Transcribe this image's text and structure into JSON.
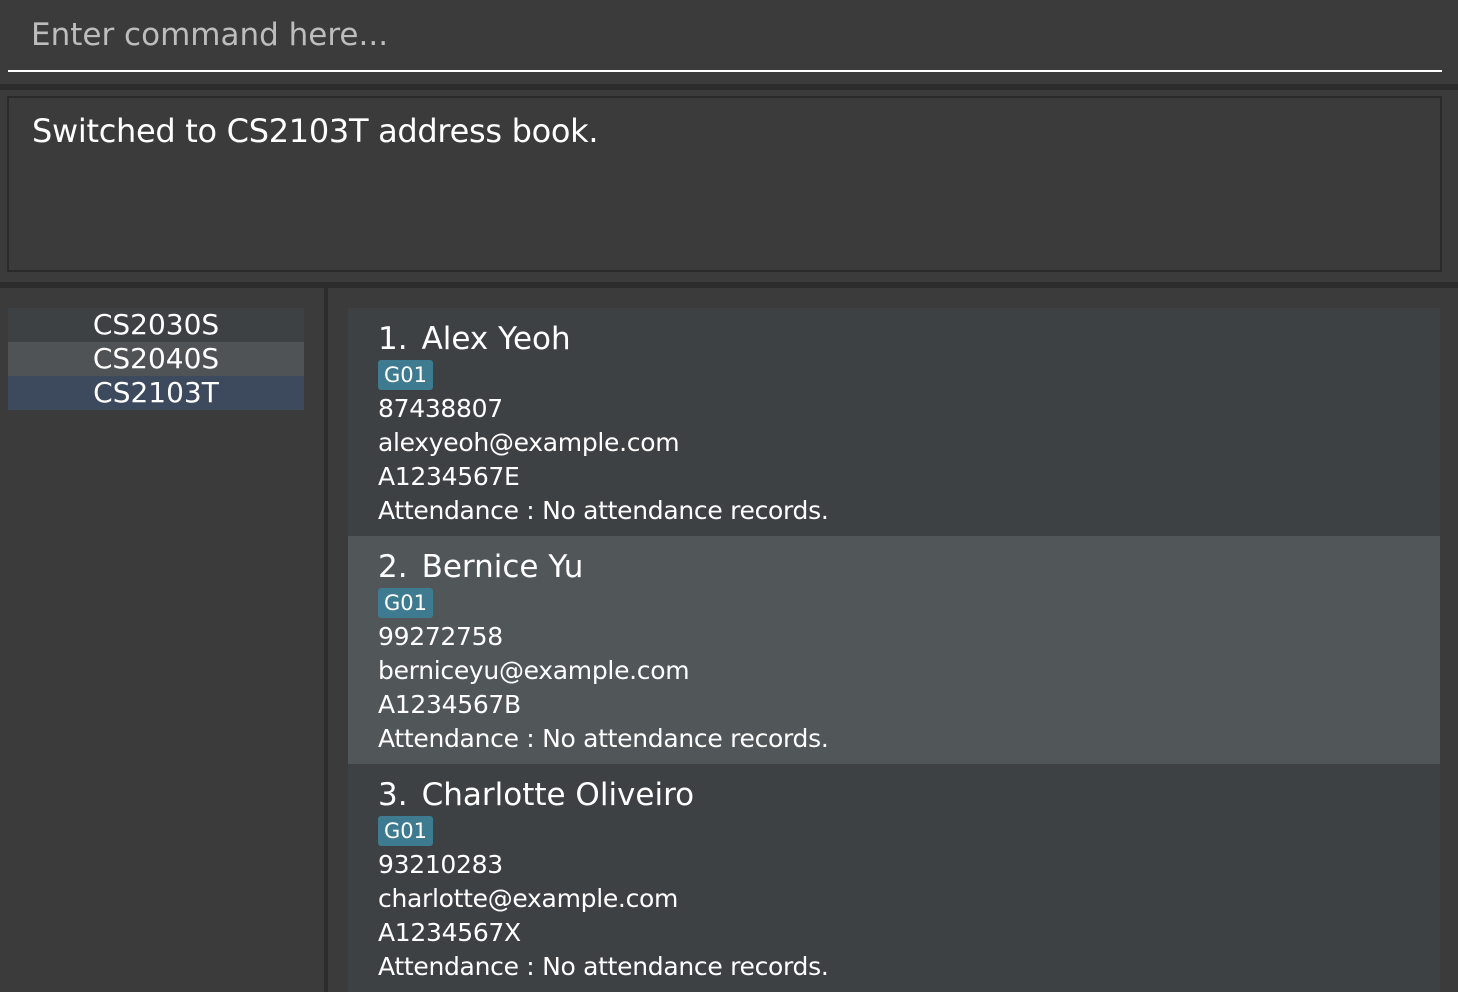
{
  "command": {
    "placeholder": "Enter command here...",
    "value": ""
  },
  "result": {
    "message": "Switched to CS2103T address book."
  },
  "address_books": {
    "items": [
      {
        "label": "CS2030S",
        "selected": false
      },
      {
        "label": "CS2040S",
        "selected": false
      },
      {
        "label": "CS2103T",
        "selected": true
      }
    ]
  },
  "persons": [
    {
      "index": "1.",
      "name": "Alex Yeoh",
      "tag": "G01",
      "phone": "87438807",
      "email": "alexyeoh@example.com",
      "student_id": "A1234567E",
      "attendance": "Attendance : No attendance records."
    },
    {
      "index": "2.",
      "name": "Bernice Yu",
      "tag": "G01",
      "phone": "99272758",
      "email": "berniceyu@example.com",
      "student_id": "A1234567B",
      "attendance": "Attendance : No attendance records."
    },
    {
      "index": "3.",
      "name": "Charlotte Oliveiro",
      "tag": "G01",
      "phone": "93210283",
      "email": "charlotte@example.com",
      "student_id": "A1234567X",
      "attendance": "Attendance : No attendance records."
    }
  ],
  "colors": {
    "background": "#3b3b3b",
    "card": "#3e4144",
    "card_alt": "#515658",
    "selected_book": "#3d4a5e",
    "tag": "#3e7b91"
  }
}
